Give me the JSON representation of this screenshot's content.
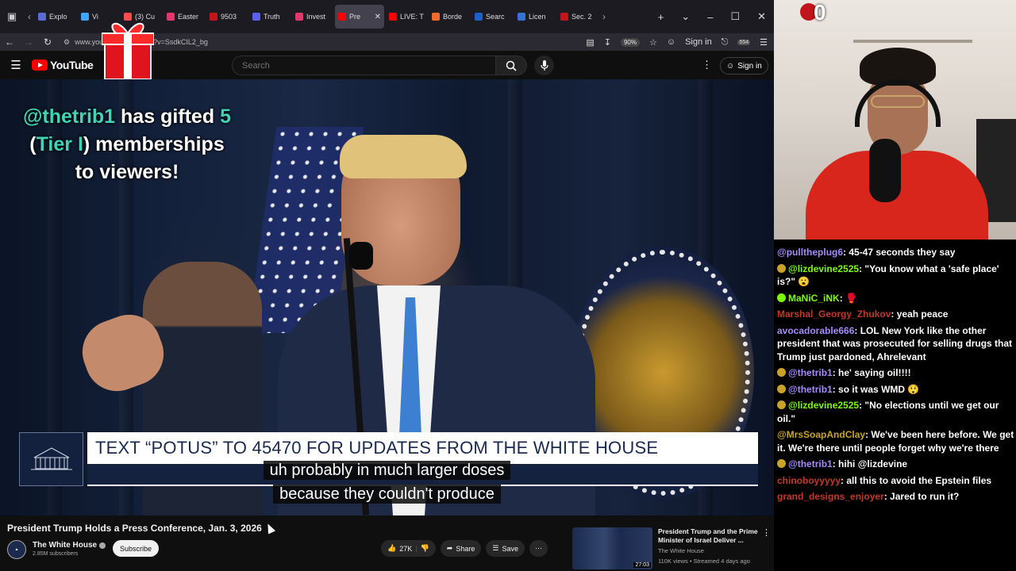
{
  "browser": {
    "tabs": [
      {
        "label": "Explo",
        "color": "#5b6bd6",
        "active": false
      },
      {
        "label": "Vi",
        "color": "#3ea6ff",
        "active": false
      },
      {
        "label": "(3) Cu",
        "color": "#ff4b4b",
        "active": false
      },
      {
        "label": "Easter",
        "color": "#e3366f",
        "active": false
      },
      {
        "label": "9503",
        "color": "#c0161b",
        "active": false
      },
      {
        "label": "Truth",
        "color": "#5d5fef",
        "active": false
      },
      {
        "label": "Invest",
        "color": "#e3366f",
        "active": false
      },
      {
        "label": "Pre",
        "color": "#ff0000",
        "active": true
      },
      {
        "label": "LIVE: T",
        "color": "#ff0000",
        "active": false
      },
      {
        "label": "Borde",
        "color": "#f06b2b",
        "active": false
      },
      {
        "label": "Searc",
        "color": "#1a62c8",
        "active": false
      },
      {
        "label": "Licen",
        "color": "#3a6fd8",
        "active": false
      },
      {
        "label": "Sec. 2",
        "color": "#c0161b",
        "active": false
      }
    ],
    "url": "www.youtube.com/watch?v=SsdkCIL2_bg",
    "zoom": "90%",
    "signin_label": "Sign in",
    "extension_count": "554"
  },
  "youtube": {
    "logo_text": "YouTube",
    "search_placeholder": "Search",
    "signin_label": "Sign in"
  },
  "video": {
    "gift": {
      "user": "@thetrib1",
      "mid1": " has gifted ",
      "count": "5",
      "open": "(",
      "tier": "Tier I",
      "close": ") memberships",
      "line3": "to viewers!"
    },
    "lower_third": "TEXT “POTUS” TO 45470 FOR UPDATES FROM THE WHITE HOUSE",
    "caption_line1": "uh probably in much larger doses",
    "caption_line2": "because they couldn't produce"
  },
  "info": {
    "title": "President Trump Holds a Press Conference, Jan. 3, 2026",
    "channel": "The White House",
    "subscribers": "2.85M subscribers",
    "subscribe_label": "Subscribe",
    "likes": "27K",
    "share_label": "Share",
    "save_label": "Save",
    "recommended": {
      "title": "President Trump and the Prime Minister of Israel Deliver ...",
      "channel": "The White House",
      "meta": "110K views • Streamed 4 days ago",
      "duration": "27:03"
    }
  },
  "webcam": {
    "counter": "0"
  },
  "chat": [
    {
      "user": "@pulltheplug6",
      "color": "#a78bfa",
      "badge": "",
      "text": ": 45-47 seconds they say"
    },
    {
      "user": "@lizdevine2525",
      "color": "#7cfc00",
      "badge": "#c9a227",
      "text": ": \"You know what a 'safe place' is?\" 😮"
    },
    {
      "user": "MaNiC_iNK",
      "color": "#7cfc00",
      "badge": "#7cfc00",
      "text": ": 🥊"
    },
    {
      "user": "Marshal_Georgy_Zhukov",
      "color": "#c0392b",
      "badge": "",
      "text": ": yeah peace"
    },
    {
      "user": "avocadorable666",
      "color": "#a78bfa",
      "badge": "",
      "text": ": LOL New York like the other president that was prosecuted for selling drugs that Trump just pardoned, Ahrelevant"
    },
    {
      "user": "@thetrib1",
      "color": "#a78bfa",
      "badge": "#c9a227",
      "text": ": he' saying oil!!!!"
    },
    {
      "user": "@thetrib1",
      "color": "#a78bfa",
      "badge": "#c9a227",
      "text": ": so it was WMD 😲"
    },
    {
      "user": "@lizdevine2525",
      "color": "#7cfc00",
      "badge": "#c9a227",
      "text": ": \"No elections until we get our oil.\""
    },
    {
      "user": "@MrsSoapAndClay",
      "color": "#c9a227",
      "badge": "",
      "text": ": We've been here before. We get it. We're there until people forget why we're there"
    },
    {
      "user": "@thetrib1",
      "color": "#a78bfa",
      "badge": "#c9a227",
      "text": ": hihi @lizdevine"
    },
    {
      "user": "chinoboyyyyy",
      "color": "#c0392b",
      "badge": "",
      "text": ": all this to avoid the Epstein files"
    },
    {
      "user": "grand_designs_enjoyer",
      "color": "#c0392b",
      "badge": "",
      "text": ": Jared to run it?"
    }
  ]
}
